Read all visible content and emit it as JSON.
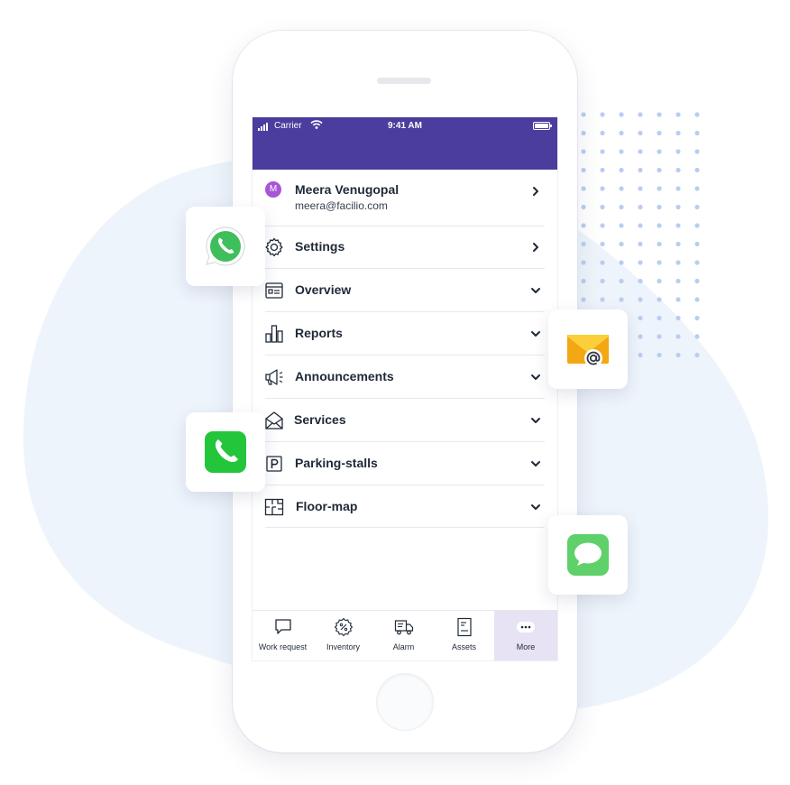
{
  "status_bar": {
    "carrier": "Carrier",
    "time": "9:41 AM"
  },
  "profile": {
    "initial": "M",
    "name": "Meera Venugopal",
    "email": "meera@facilio.com"
  },
  "menu": [
    {
      "label": "Settings",
      "icon": "gear-icon",
      "chevron": "right"
    },
    {
      "label": "Overview",
      "icon": "dashboard-card-icon",
      "chevron": "down"
    },
    {
      "label": "Reports",
      "icon": "bar-chart-icon",
      "chevron": "down"
    },
    {
      "label": "Announcements",
      "icon": "megaphone-icon",
      "chevron": "down"
    },
    {
      "label": "Services",
      "icon": "envelope-open-icon",
      "chevron": "down"
    },
    {
      "label": "Parking-stalls",
      "icon": "parking-icon",
      "chevron": "down"
    },
    {
      "label": "Floor-map",
      "icon": "floor-plan-icon",
      "chevron": "down"
    }
  ],
  "tabs": [
    {
      "label": "Work request",
      "icon": "chat-bubble-icon",
      "active": false
    },
    {
      "label": "Inventory",
      "icon": "percent-badge-icon",
      "active": false
    },
    {
      "label": "Alarm",
      "icon": "truck-icon",
      "active": false
    },
    {
      "label": "Assets",
      "icon": "document-icon",
      "active": false
    },
    {
      "label": "More",
      "icon": "more-dots-icon",
      "active": true
    }
  ],
  "floating_apps": [
    {
      "name": "WhatsApp",
      "icon": "whatsapp-icon"
    },
    {
      "name": "Phone",
      "icon": "phone-icon"
    },
    {
      "name": "Email",
      "icon": "email-at-icon"
    },
    {
      "name": "Messages",
      "icon": "message-bubble-icon"
    }
  ],
  "colors": {
    "header": "#4a3d9d",
    "avatar": "#a855d8",
    "active_tab": "#e7e3f5",
    "background_blob": "#eef4fb",
    "dots": "#b9cdf2"
  }
}
